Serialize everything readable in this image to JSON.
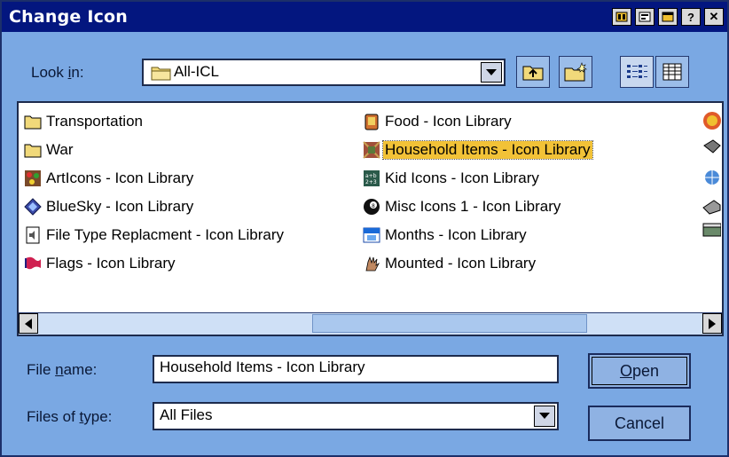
{
  "window": {
    "title": "Change Icon"
  },
  "titlebar_buttons": [
    "ico-button",
    "ico-button-2",
    "maximize-button",
    "help-button",
    "close-button"
  ],
  "help_glyph": "?",
  "close_glyph": "✕",
  "look_in": {
    "label_pre": "Look ",
    "label_u": "i",
    "label_post": "n:",
    "value": "All-ICL"
  },
  "files": [
    {
      "label": "Transportation",
      "icon": "folder-icon"
    },
    {
      "label": "War",
      "icon": "folder-icon"
    },
    {
      "label": "ArtIcons - Icon Library",
      "icon": "art-icon"
    },
    {
      "label": "BlueSky - Icon Library",
      "icon": "bluesky-icon"
    },
    {
      "label": "File Type Replacment - Icon Library",
      "icon": "file-type-icon"
    },
    {
      "label": "Flags - Icon Library",
      "icon": "flag-icon"
    },
    {
      "label": "Food - Icon Library",
      "icon": "food-icon"
    },
    {
      "label": "Household Items - Icon Library",
      "icon": "household-icon",
      "selected": true
    },
    {
      "label": "Kid Icons - Icon Library",
      "icon": "kid-icon"
    },
    {
      "label": "Misc Icons 1 - Icon Library",
      "icon": "misc-icon"
    },
    {
      "label": "Months - Icon Library",
      "icon": "months-icon"
    },
    {
      "label": "Mounted - Icon Library",
      "icon": "mounted-icon"
    }
  ],
  "file_name": {
    "label_pre": "File ",
    "label_u": "n",
    "label_post": "ame:",
    "value": "Household Items - Icon Library"
  },
  "file_type": {
    "label_pre": "Files of ",
    "label_u": "t",
    "label_post": "ype:",
    "value": "All Files"
  },
  "buttons": {
    "open_u": "O",
    "open_rest": "pen",
    "cancel": "Cancel"
  },
  "colors": {
    "titlebar": "#03167f",
    "dialog": "#7aa8e3",
    "selection": "#f2c237"
  }
}
